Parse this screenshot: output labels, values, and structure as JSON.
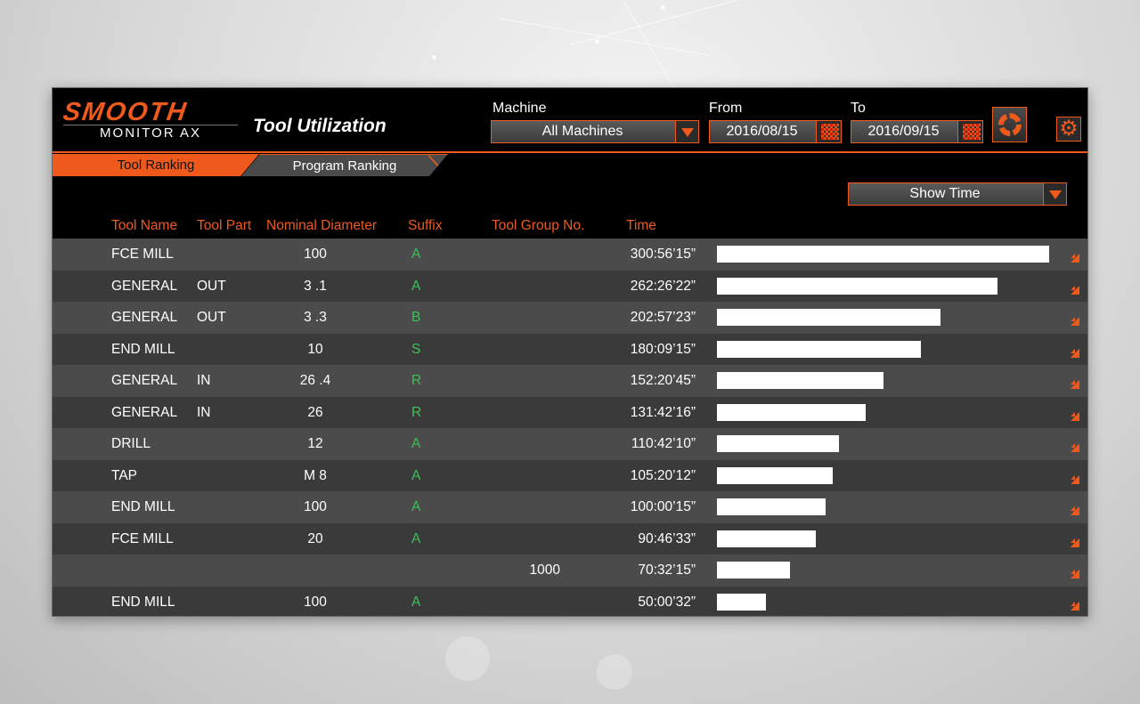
{
  "logo": {
    "line1": "SMOOTH",
    "line2": "MONITOR AX"
  },
  "page_title": "Tool Utilization",
  "machine": {
    "label": "Machine",
    "value": "All Machines"
  },
  "from": {
    "label": "From",
    "value": "2016/08/15"
  },
  "to": {
    "label": "To",
    "value": "2016/09/15"
  },
  "tabs": [
    {
      "label": "Tool Ranking",
      "active": true
    },
    {
      "label": "Program Ranking",
      "active": false
    }
  ],
  "view_select": {
    "value": "Show Time"
  },
  "columns": {
    "tool_name": "Tool Name",
    "tool_part": "Tool Part",
    "nominal_diameter": "Nominal Diameter",
    "suffix": "Suffix",
    "tool_group": "Tool Group No.",
    "time": "Time"
  },
  "colors": {
    "accent": "#ef5a1c",
    "suffix": "#3fbf5a",
    "row_odd": "#4b4b4b",
    "row_even": "#3a3a3a"
  },
  "rows": [
    {
      "tool_name": "FCE MILL",
      "tool_part": "",
      "diameter": "100",
      "suffix": "A",
      "group": "",
      "time": "300:56’15”",
      "ratio": 1.0
    },
    {
      "tool_name": "GENERAL",
      "tool_part": "OUT",
      "diameter": "3 .1",
      "suffix": "A",
      "group": "",
      "time": "262:26’22”",
      "ratio": 0.844
    },
    {
      "tool_name": "GENERAL",
      "tool_part": "OUT",
      "diameter": "3 .3",
      "suffix": "B",
      "group": "",
      "time": "202:57’23”",
      "ratio": 0.672
    },
    {
      "tool_name": "END MILL",
      "tool_part": "",
      "diameter": "10",
      "suffix": "S",
      "group": "",
      "time": "180:09’15”",
      "ratio": 0.615
    },
    {
      "tool_name": "GENERAL",
      "tool_part": "IN",
      "diameter": "26 .4",
      "suffix": "R",
      "group": "",
      "time": "152:20’45”",
      "ratio": 0.5
    },
    {
      "tool_name": "GENERAL",
      "tool_part": "IN",
      "diameter": "26",
      "suffix": "R",
      "group": "",
      "time": "131:42’16”",
      "ratio": 0.449
    },
    {
      "tool_name": "DRILL",
      "tool_part": "",
      "diameter": "12",
      "suffix": "A",
      "group": "",
      "time": "110:42’10”",
      "ratio": 0.366
    },
    {
      "tool_name": "TAP",
      "tool_part": "",
      "diameter": "M  8",
      "suffix": "A",
      "group": "",
      "time": "105:20’12”",
      "ratio": 0.348
    },
    {
      "tool_name": "END MILL",
      "tool_part": "",
      "diameter": "100",
      "suffix": "A",
      "group": "",
      "time": "100:00’15”",
      "ratio": 0.328
    },
    {
      "tool_name": "FCE MILL",
      "tool_part": "",
      "diameter": "20",
      "suffix": "A",
      "group": "",
      "time": "90:46’33”",
      "ratio": 0.297
    },
    {
      "tool_name": "",
      "tool_part": "",
      "diameter": "",
      "suffix": "",
      "group": "1000",
      "time": "70:32’15”",
      "ratio": 0.219
    },
    {
      "tool_name": "END MILL",
      "tool_part": "",
      "diameter": "100",
      "suffix": "A",
      "group": "",
      "time": "50:00’32”",
      "ratio": 0.148
    }
  ]
}
